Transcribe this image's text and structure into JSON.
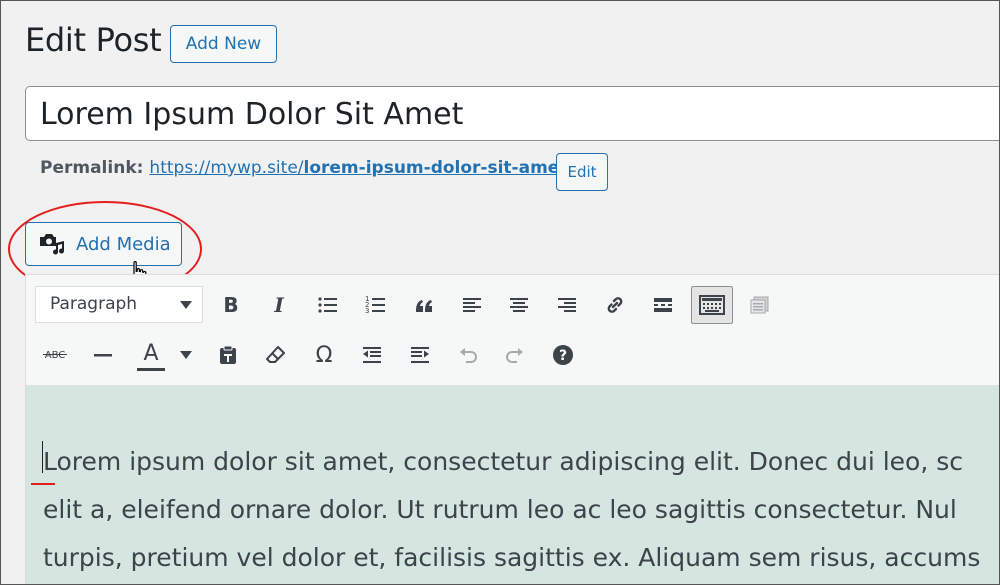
{
  "header": {
    "page_title": "Edit Post",
    "add_new_label": "Add New"
  },
  "title_field": {
    "value": "Lorem Ipsum Dolor Sit Amet"
  },
  "permalink": {
    "label": "Permalink:",
    "url_base": "https://mywp.site/",
    "url_slug": "lorem-ipsum-dolor-sit-amet",
    "url_trailing": "/",
    "edit_label": "Edit"
  },
  "media": {
    "add_media_label": "Add Media",
    "icon": "media-icon"
  },
  "toolbar": {
    "format_select_value": "Paragraph",
    "row1_icons": [
      "bold-icon",
      "italic-icon",
      "bullet-list-icon",
      "numbered-list-icon",
      "blockquote-icon",
      "align-left-icon",
      "align-center-icon",
      "align-right-icon",
      "link-icon",
      "read-more-icon",
      "toolbar-toggle-icon",
      "insert-image-icon"
    ],
    "row2_icons": [
      "strikethrough-icon",
      "horizontal-line-icon",
      "text-color-icon",
      "text-color-dropdown-icon",
      "paste-text-icon",
      "clear-formatting-icon",
      "special-character-icon",
      "outdent-icon",
      "indent-icon",
      "undo-icon",
      "redo-icon",
      "help-icon"
    ],
    "bold_label": "B",
    "italic_label": "I",
    "strike_label": "ABC",
    "text_color_label": "A",
    "omega_label": "Ω"
  },
  "content": {
    "lines": [
      "Lorem ipsum dolor sit amet, consectetur adipiscing elit. Donec dui leo, sc",
      "elit a, eleifend ornare dolor. Ut rutrum leo ac leo sagittis consectetur. Nul",
      "turpis, pretium vel dolor et, facilisis sagittis ex. Aliquam sem risus, accums"
    ]
  },
  "colors": {
    "accent": "#2271b1",
    "highlight": "#e41d1d",
    "content_bg": "#d5e5e0"
  }
}
